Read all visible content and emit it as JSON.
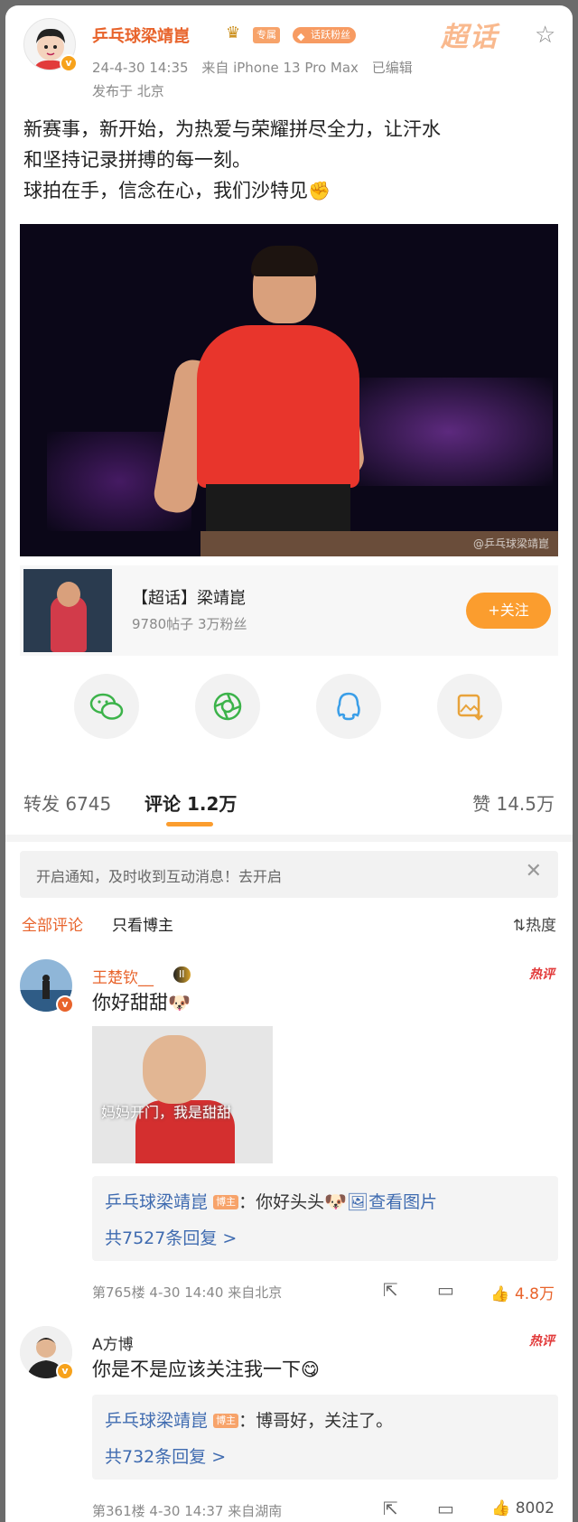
{
  "post": {
    "author": "乒乓球梁靖崑",
    "tag_special": "专属",
    "tag_fan": "话跃粉丝",
    "chaohua_logo": "超话",
    "meta_date": "24-4-30 14:35",
    "meta_source": "来自 iPhone 13 Pro Max",
    "meta_edited": "已编辑",
    "location": "发布于 北京",
    "text_line1": "新赛事，新开始，为热爱与荣耀拼尽全力，让汗水",
    "text_line2": "和坚持记录拼搏的每一刻。",
    "text_line3": "球拍在手，信念在心，我们沙特见",
    "photo_watermark": "@乒乓球梁靖崑"
  },
  "topic": {
    "title": "【超话】梁靖崑",
    "sub": "9780帖子 3万粉丝",
    "follow_label": "+关注"
  },
  "share": [
    {
      "icon": "wechat-icon"
    },
    {
      "icon": "moments-icon"
    },
    {
      "icon": "qq-icon"
    },
    {
      "icon": "save-image-icon"
    }
  ],
  "stats": {
    "repost": "转发 6745",
    "comment": "评论 1.2万",
    "like": "赞 14.5万"
  },
  "notice": {
    "text": "开启通知，及时收到互动消息！去开启",
    "close": "✕"
  },
  "filters": {
    "all": "全部评论",
    "owner": "只看博主",
    "hot": "热度"
  },
  "comments": [
    {
      "name": "王楚钦__",
      "level_badge": "II",
      "hot_tag": "热评",
      "text": "你好甜甜",
      "image_caption": "妈妈开门，我是甜甜",
      "reply_who": "乒乓球梁靖崑",
      "reply_tag": "博主",
      "reply_text": "：你好头头",
      "reply_link": "查看图片",
      "reply_count": "共7527条回复 >",
      "floor": "第765楼",
      "time": "4-30 14:40",
      "from": "来自北京",
      "likes": "4.8万"
    },
    {
      "name": "A方博",
      "hot_tag": "热评",
      "text": "你是不是应该关注我一下",
      "reply_who": "乒乓球梁靖崑",
      "reply_tag": "博主",
      "reply_text": "：博哥好，关注了。",
      "reply_count": "共732条回复 >",
      "floor": "第361楼",
      "time": "4-30 14:37",
      "from": "来自湖南",
      "likes": "8002"
    }
  ]
}
